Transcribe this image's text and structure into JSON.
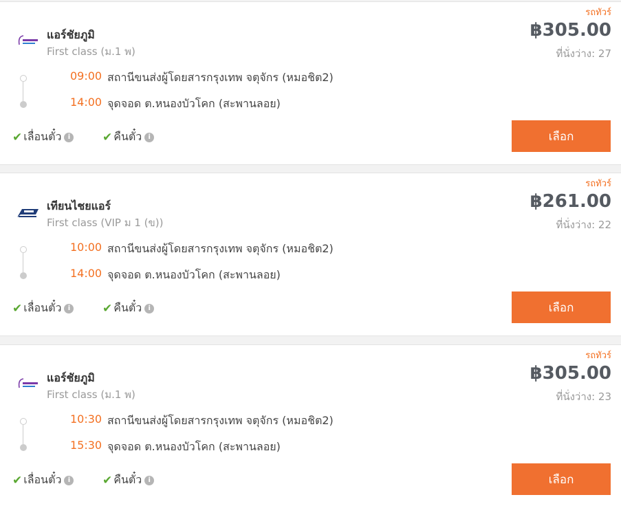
{
  "cards": [
    {
      "badge": "รถทัวร์",
      "operator": "แอร์ชัยภูมิ",
      "seat_class": "First class (ม.1 พ)",
      "price": "฿305.00",
      "seats_available": "ที่นั่งว่าง: 27",
      "departure": {
        "time": "09:00",
        "place": "สถานีขนส่งผู้โดยสารกรุงเทพ จตุจักร (หมอชิต2)"
      },
      "arrival": {
        "time": "14:00",
        "place": "จุดจอด ต.หนองบัวโคก (สะพานลอย)"
      },
      "policy_change": "เลื่อนตั๋ว",
      "policy_refund": "คืนตั๋ว",
      "select_label": "เลือก",
      "logo_icon": "air-chaiyaphum-logo"
    },
    {
      "badge": "รถทัวร์",
      "operator": "เทียนไชยแอร์",
      "seat_class": "First class (VIP ม 1 (ข))",
      "price": "฿261.00",
      "seats_available": "ที่นั่งว่าง: 22",
      "departure": {
        "time": "10:00",
        "place": "สถานีขนส่งผู้โดยสารกรุงเทพ จตุจักร (หมอชิต2)"
      },
      "arrival": {
        "time": "14:00",
        "place": "จุดจอด ต.หนองบัวโคก (สะพานลอย)"
      },
      "policy_change": "เลื่อนตั๋ว",
      "policy_refund": "คืนตั๋ว",
      "select_label": "เลือก",
      "logo_icon": "tianchai-air-logo"
    },
    {
      "badge": "รถทัวร์",
      "operator": "แอร์ชัยภูมิ",
      "seat_class": "First class (ม.1 พ)",
      "price": "฿305.00",
      "seats_available": "ที่นั่งว่าง: 23",
      "departure": {
        "time": "10:30",
        "place": "สถานีขนส่งผู้โดยสารกรุงเทพ จตุจักร (หมอชิต2)"
      },
      "arrival": {
        "time": "15:30",
        "place": "จุดจอด ต.หนองบัวโคก (สะพานลอย)"
      },
      "policy_change": "เลื่อนตั๋ว",
      "policy_refund": "คืนตั๋ว",
      "select_label": "เลือก",
      "logo_icon": "air-chaiyaphum-logo"
    }
  ],
  "colors": {
    "accent": "#f37021",
    "button": "#f07030",
    "check": "#5aa832",
    "price": "#555a61"
  }
}
